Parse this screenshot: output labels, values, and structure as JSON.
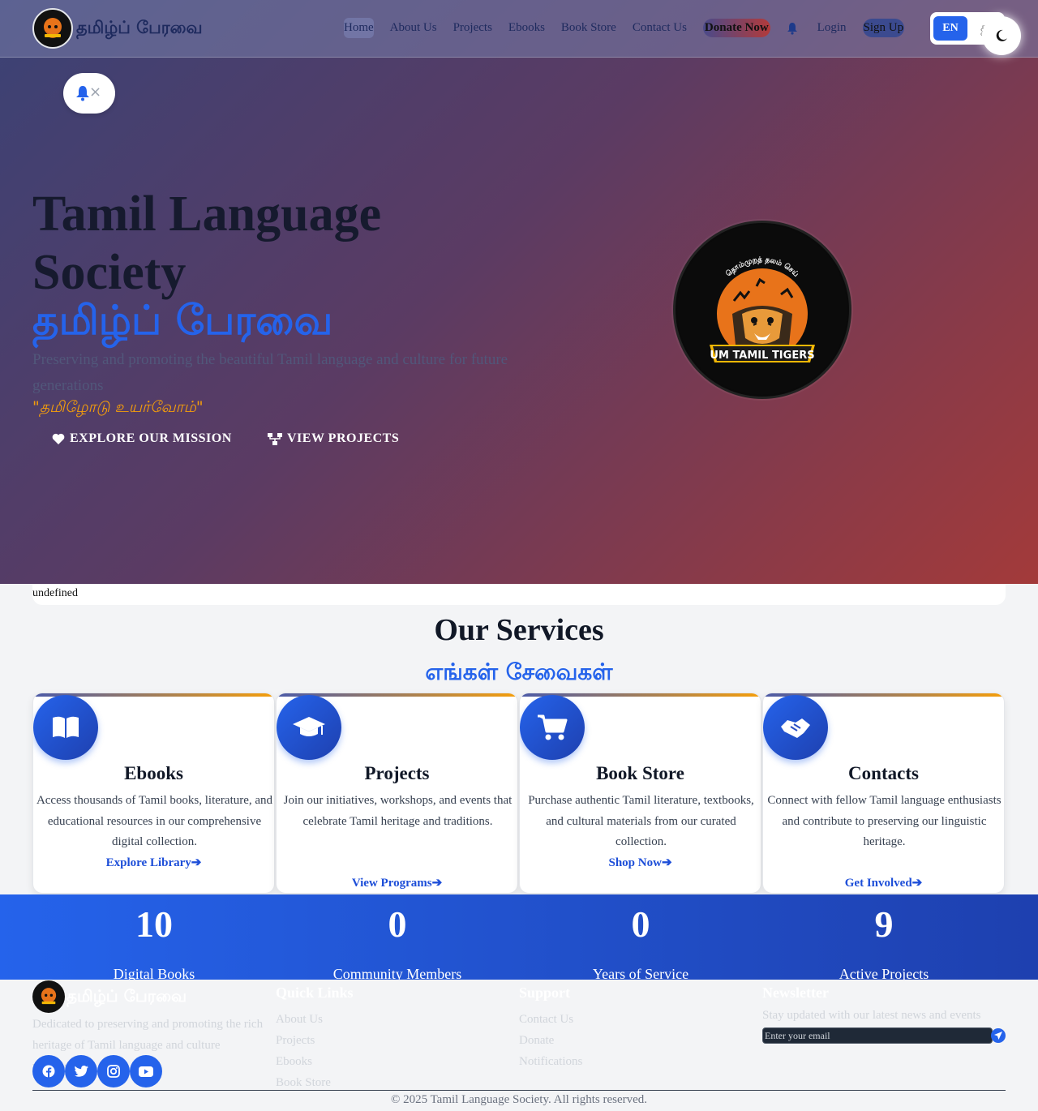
{
  "nav": {
    "brand": "தமிழ்ப் பேரவை",
    "links": [
      "Home",
      "About Us",
      "Projects",
      "Ebooks",
      "Book Store",
      "Contact Us"
    ],
    "donate": "Donate Now",
    "login": "Login",
    "signup": "Sign Up",
    "lang_en": "EN",
    "lang_ta": "த"
  },
  "notification": {
    "close": "×"
  },
  "hero": {
    "title": "Tamil Language Society",
    "tamil_title": "தமிழ்ப் பேரவை",
    "description": "Preserving and promoting the beautiful Tamil language and culture for future generations",
    "quote": "\"தமிழோடு உயர்வோம்\"",
    "btn_mission": "EXPLORE OUR MISSION",
    "btn_projects": "VIEW PROJECTS",
    "logo_arc_text": "தொம்முறத் தலம் செய்",
    "logo_banner": "UM TAMIL TIGERS"
  },
  "broken_image_alt": "undefined",
  "services": {
    "title": "Our Services",
    "tamil_title": "எங்கள் சேவைகள்",
    "cards": [
      {
        "icon": "book-open-icon",
        "title": "Ebooks",
        "desc": "Access thousands of Tamil books, literature, and educational resources in our comprehensive digital collection.",
        "link": "Explore Library"
      },
      {
        "icon": "graduation-cap-icon",
        "title": "Projects",
        "desc": "Join our initiatives, workshops, and events that celebrate Tamil heritage and traditions.",
        "link": "View Programs"
      },
      {
        "icon": "shopping-cart-icon",
        "title": "Book Store",
        "desc": "Purchase authentic Tamil literature, textbooks, and cultural materials from our curated collection.",
        "link": "Shop Now"
      },
      {
        "icon": "handshake-icon",
        "title": "Contacts",
        "desc": "Connect with fellow Tamil language enthusiasts and contribute to preserving our linguistic heritage.",
        "link": "Get Involved"
      }
    ]
  },
  "stats": [
    {
      "value": "10",
      "label": "Digital Books"
    },
    {
      "value": "0",
      "label": "Community Members"
    },
    {
      "value": "0",
      "label": "Years of Service"
    },
    {
      "value": "9",
      "label": "Active Projects"
    }
  ],
  "footer": {
    "brand": "தமிழ்ப் பேரவை",
    "desc": "Dedicated to preserving and promoting the rich heritage of Tamil language and culture worldwide.",
    "quick_links_title": "Quick Links",
    "quick_links": [
      "About Us",
      "Projects",
      "Ebooks",
      "Book Store"
    ],
    "support_title": "Support",
    "support_links": [
      "Contact Us",
      "Donate",
      "Notifications"
    ],
    "newsletter_title": "Newsletter",
    "newsletter_text": "Stay updated with our latest news and events",
    "email_placeholder": "Enter your email",
    "copyright": "© 2025 Tamil Language Society. All rights reserved."
  },
  "colors": {
    "primary": "#2563eb",
    "accent": "#f59e0b",
    "dark": "#111827"
  }
}
